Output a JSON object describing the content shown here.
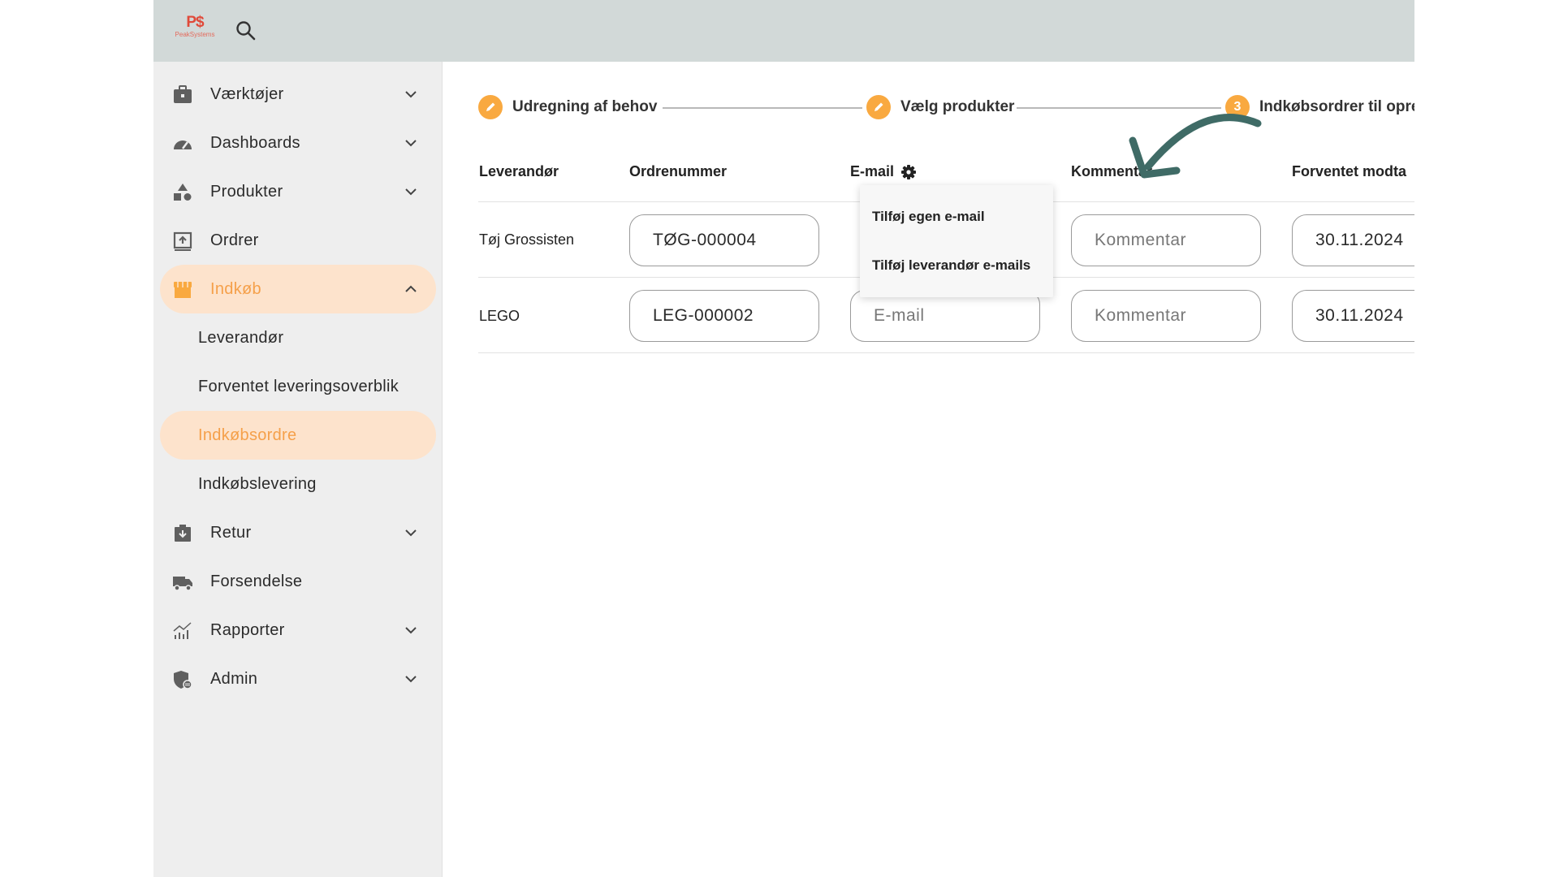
{
  "header": {
    "logo_mark": "P$",
    "logo_text": "PeakSystems",
    "icons": [
      "search-icon"
    ]
  },
  "sidebar": {
    "items": [
      {
        "label": "Værktøjer",
        "icon": "toolbox-icon",
        "chevron": "down"
      },
      {
        "label": "Dashboards",
        "icon": "gauge-icon",
        "chevron": "down"
      },
      {
        "label": "Produkter",
        "icon": "shapes-icon",
        "chevron": "down"
      },
      {
        "label": "Ordrer",
        "icon": "order-icon"
      },
      {
        "label": "Indkøb",
        "icon": "store-icon",
        "chevron": "up",
        "active": true
      },
      {
        "label": "Retur",
        "icon": "return-box-icon",
        "chevron": "down"
      },
      {
        "label": "Forsendelse",
        "icon": "truck-icon"
      },
      {
        "label": "Rapporter",
        "icon": "chart-icon",
        "chevron": "down"
      },
      {
        "label": "Admin",
        "icon": "shield-icon",
        "chevron": "down"
      }
    ],
    "sub_items": [
      {
        "label": "Leverandør"
      },
      {
        "label": "Forventet leveringsoverblik"
      },
      {
        "label": "Indkøbsordre",
        "active": true
      },
      {
        "label": "Indkøbslevering"
      }
    ]
  },
  "stepper": {
    "steps": [
      {
        "label": "Udregning af behov",
        "state": "done",
        "icon": "pencil-icon"
      },
      {
        "label": "Vælg produkter",
        "state": "done",
        "icon": "pencil-icon"
      },
      {
        "label": "Indkøbsordrer til opret",
        "state": "current",
        "number": "3"
      }
    ]
  },
  "table": {
    "columns": [
      "Leverandør",
      "Ordrenummer",
      "E-mail",
      "Kommentar",
      "Forventet modta"
    ],
    "email_settings_icon": "gear-icon",
    "rows": [
      {
        "supplier": "Tøj Grossisten",
        "order_number": "TØG-000004",
        "email": "",
        "comment": "",
        "expected_date": "30.11.2024"
      },
      {
        "supplier": "LEGO",
        "order_number": "LEG-000002",
        "email": "",
        "comment": "",
        "expected_date": "30.11.2024"
      }
    ],
    "placeholders": {
      "email": "E-mail",
      "comment": "Kommentar"
    }
  },
  "email_menu": {
    "items": [
      "Tilføj egen e-mail",
      "Tilføj leverandør e-mails"
    ]
  },
  "annotation": {
    "arrow_color": "#3f6b66"
  },
  "colors": {
    "accent": "#f9a940",
    "active_bg": "#fde3cc",
    "active_text": "#f5a04a",
    "topbar": "#d2d9d8",
    "sidebar": "#eeeeee"
  }
}
